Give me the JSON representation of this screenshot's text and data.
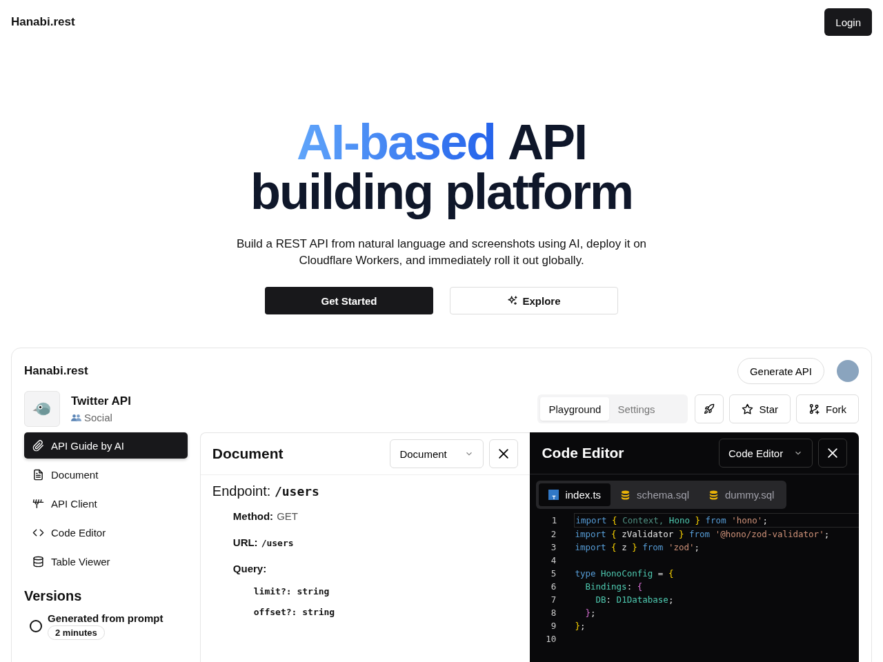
{
  "nav": {
    "brand": "Hanabi.rest",
    "login": "Login"
  },
  "hero": {
    "title_lines": [
      [
        {
          "text": "AI-based",
          "kind": "gradient"
        },
        {
          "text": "API",
          "kind": "plain"
        }
      ],
      [
        {
          "text": "building platform",
          "kind": "plain"
        }
      ]
    ],
    "subtitle": "Build a REST API from natural language and screenshots using AI, deploy it on Cloudflare Workers, and immediately roll it out globally.",
    "buttons": [
      {
        "label": "Get Started",
        "kind": "primary"
      },
      {
        "label": "Explore",
        "kind": "outline"
      }
    ]
  },
  "app": {
    "brand": "Hanabi.rest",
    "generate": "Generate API",
    "project": {
      "name": "Twitter API",
      "category": "Social"
    },
    "tabs": [
      {
        "label": "Playground",
        "selected": true
      },
      {
        "label": "Settings",
        "selected": false
      }
    ],
    "actions": [
      {
        "label": "Star"
      },
      {
        "label": "Fork"
      }
    ],
    "sidebar": [
      {
        "label": "API Guide by AI",
        "selected": true
      },
      {
        "label": "Document",
        "selected": false
      },
      {
        "label": "API Client",
        "selected": false
      },
      {
        "label": "Code Editor",
        "selected": false
      },
      {
        "label": "Table Viewer",
        "selected": false
      }
    ],
    "versions": {
      "title": "Versions",
      "items": [
        {
          "title": "Generated from prompt",
          "time": "2 minutes",
          "selected": false
        }
      ]
    },
    "document": {
      "title": "Document",
      "select": "Document",
      "heading": "Endpoint:",
      "heading_code": "/users",
      "items": [
        {
          "label": "Method:",
          "value": "GET",
          "kind": "text"
        },
        {
          "label": "URL:",
          "value": "/users",
          "kind": "code"
        },
        {
          "label": "Query:",
          "kind": "group",
          "children": [
            "limit?: string",
            "offset?: string"
          ]
        }
      ]
    },
    "editor": {
      "title": "Code Editor",
      "select": "Code Editor",
      "files": [
        {
          "name": "index.ts",
          "kind": "ts",
          "selected": true
        },
        {
          "name": "schema.sql",
          "kind": "sql",
          "selected": false
        },
        {
          "name": "dummy.sql",
          "kind": "sql",
          "selected": false
        }
      ],
      "lines": [
        {
          "number": "1",
          "tokens": [
            {
              "text": "import",
              "kind": "kw"
            },
            {
              "text": " {",
              "kind": "brace"
            },
            {
              "text": " Context,",
              "kind": "dim"
            },
            {
              "text": " Hono",
              "kind": "type"
            },
            {
              "text": " }",
              "kind": "brace"
            },
            {
              "text": " from",
              "kind": "kw"
            },
            {
              "text": " 'hono'",
              "kind": "str"
            },
            {
              "text": ";",
              "kind": "plain"
            }
          ]
        },
        {
          "number": "2",
          "tokens": [
            {
              "text": "import",
              "kind": "kw"
            },
            {
              "text": " {",
              "kind": "brace"
            },
            {
              "text": " zValidator",
              "kind": "plain"
            },
            {
              "text": " }",
              "kind": "brace"
            },
            {
              "text": " from",
              "kind": "kw"
            },
            {
              "text": " '@hono/zod-validator'",
              "kind": "str"
            },
            {
              "text": ";",
              "kind": "plain"
            }
          ]
        },
        {
          "number": "3",
          "tokens": [
            {
              "text": "import",
              "kind": "kw"
            },
            {
              "text": " {",
              "kind": "brace"
            },
            {
              "text": " z",
              "kind": "plain"
            },
            {
              "text": " }",
              "kind": "brace"
            },
            {
              "text": " from",
              "kind": "kw"
            },
            {
              "text": " 'zod'",
              "kind": "str"
            },
            {
              "text": ";",
              "kind": "plain"
            }
          ]
        },
        {
          "number": "4"
        },
        {
          "number": "5",
          "tokens": [
            {
              "text": "type",
              "kind": "kw"
            },
            {
              "text": " HonoConfig",
              "kind": "type"
            },
            {
              "text": " =",
              "kind": "plain"
            },
            {
              "text": " {",
              "kind": "brace"
            }
          ]
        },
        {
          "number": "6",
          "tokens": [
            {
              "text": "  Bindings",
              "kind": "type"
            },
            {
              "text": ":",
              "kind": "plain"
            },
            {
              "text": " {",
              "kind": "brace2"
            }
          ]
        },
        {
          "number": "7",
          "tokens": [
            {
              "text": "    DB",
              "kind": "type"
            },
            {
              "text": ":",
              "kind": "plain"
            },
            {
              "text": " D1Database",
              "kind": "type"
            },
            {
              "text": ";",
              "kind": "plain"
            }
          ]
        },
        {
          "number": "8",
          "tokens": [
            {
              "text": "  }",
              "kind": "brace2"
            },
            {
              "text": ";",
              "kind": "plain"
            }
          ]
        },
        {
          "number": "9",
          "tokens": [
            {
              "text": "}",
              "kind": "brace"
            },
            {
              "text": ";",
              "kind": "plain"
            }
          ]
        },
        {
          "number": "10"
        }
      ]
    }
  }
}
